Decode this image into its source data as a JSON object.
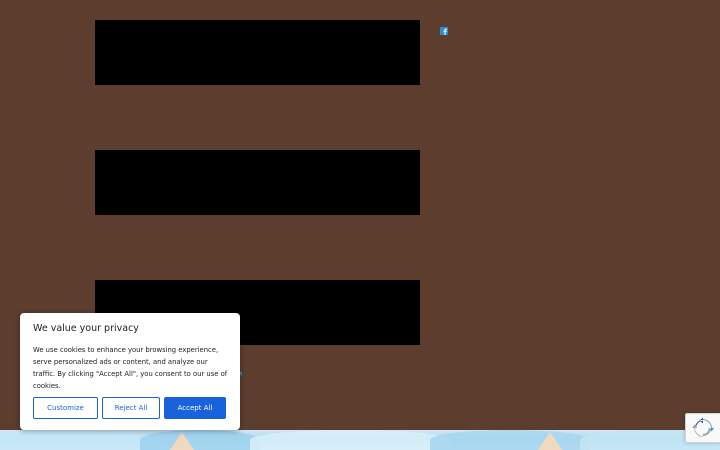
{
  "colors": {
    "page_background": "#5c3d2e",
    "video_placeholder": "#000000",
    "accent_blue": "#1863dc",
    "icon_blue": "#2b8fd6"
  },
  "icons": {
    "social": "facebook-icon",
    "recaptcha": "recaptcha-icon"
  },
  "cookie_banner": {
    "title": "We value your privacy",
    "body": "We use cookies to enhance your browsing experience, serve personalized ads or content, and analyze our traffic. By clicking \"Accept All\", you consent to our use of cookies.",
    "customize_label": "Customize",
    "reject_label": "Reject All",
    "accept_label": "Accept All"
  }
}
